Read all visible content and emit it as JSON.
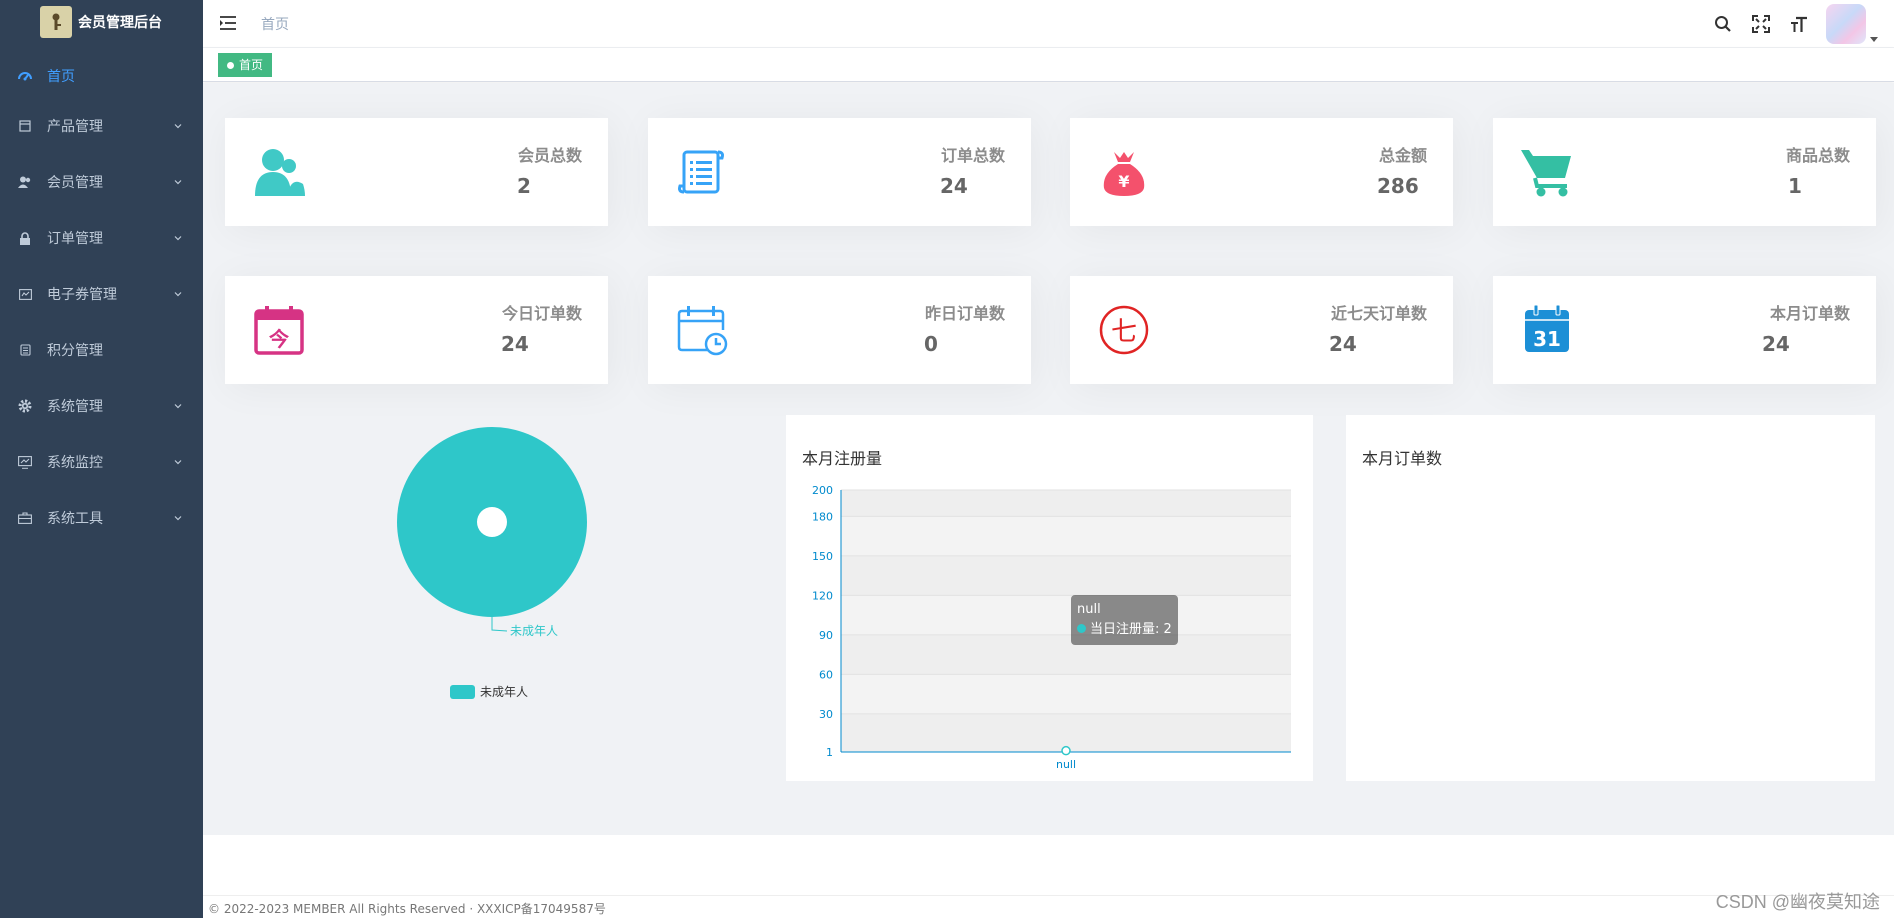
{
  "app": {
    "title": "会员管理后台"
  },
  "sidebar": {
    "items": [
      {
        "label": "首页",
        "icon": "dashboard-icon",
        "active": true
      },
      {
        "label": "产品管理",
        "icon": "product-icon"
      },
      {
        "label": "会员管理",
        "icon": "members-icon"
      },
      {
        "label": "订单管理",
        "icon": "lock-icon"
      },
      {
        "label": "电子券管理",
        "icon": "coupon-icon"
      },
      {
        "label": "积分管理",
        "icon": "points-icon"
      },
      {
        "label": "系统管理",
        "icon": "gear-icon"
      },
      {
        "label": "系统监控",
        "icon": "monitor-icon"
      },
      {
        "label": "系统工具",
        "icon": "toolbox-icon"
      }
    ]
  },
  "navbar": {
    "breadcrumb": "首页"
  },
  "tags": {
    "active": "首页"
  },
  "stats_row1": [
    {
      "label": "会员总数",
      "value": "2",
      "color": "#40c9c6"
    },
    {
      "label": "订单总数",
      "value": "24",
      "color": "#36a3f7"
    },
    {
      "label": "总金额",
      "value": "286",
      "color": "#f4516c"
    },
    {
      "label": "商品总数",
      "value": "1",
      "color": "#34bfa3"
    }
  ],
  "stats_row2": [
    {
      "label": "今日订单数",
      "value": "24",
      "color": "#d63384"
    },
    {
      "label": "昨日订单数",
      "value": "0",
      "color": "#36a3f7"
    },
    {
      "label": "近七天订单数",
      "value": "24",
      "color": "#e02424"
    },
    {
      "label": "本月订单数",
      "value": "24",
      "color": "#1c8fd6"
    }
  ],
  "chart_data": [
    {
      "type": "pie",
      "title": "",
      "labels": [
        "未成年人"
      ],
      "values": [
        2
      ],
      "legend": [
        "未成年人"
      ],
      "colors": [
        "#2ec7c9"
      ]
    },
    {
      "type": "line",
      "title": "本月注册量",
      "categories": [
        "null"
      ],
      "series": [
        {
          "name": "当日注册量",
          "values": [
            2
          ]
        }
      ],
      "yticks": [
        1,
        30,
        60,
        90,
        120,
        150,
        180,
        200
      ],
      "ylim": [
        1,
        200
      ],
      "tooltip": {
        "header": "null",
        "text": "当日注册量: 2"
      }
    },
    {
      "type": "line",
      "title": "本月订单数",
      "categories": [],
      "series": []
    }
  ],
  "footer": {
    "text": "© 2022-2023 MEMBER All Rights Reserved · XXXICP备17049587号"
  },
  "watermark": "CSDN @幽夜莫知途"
}
